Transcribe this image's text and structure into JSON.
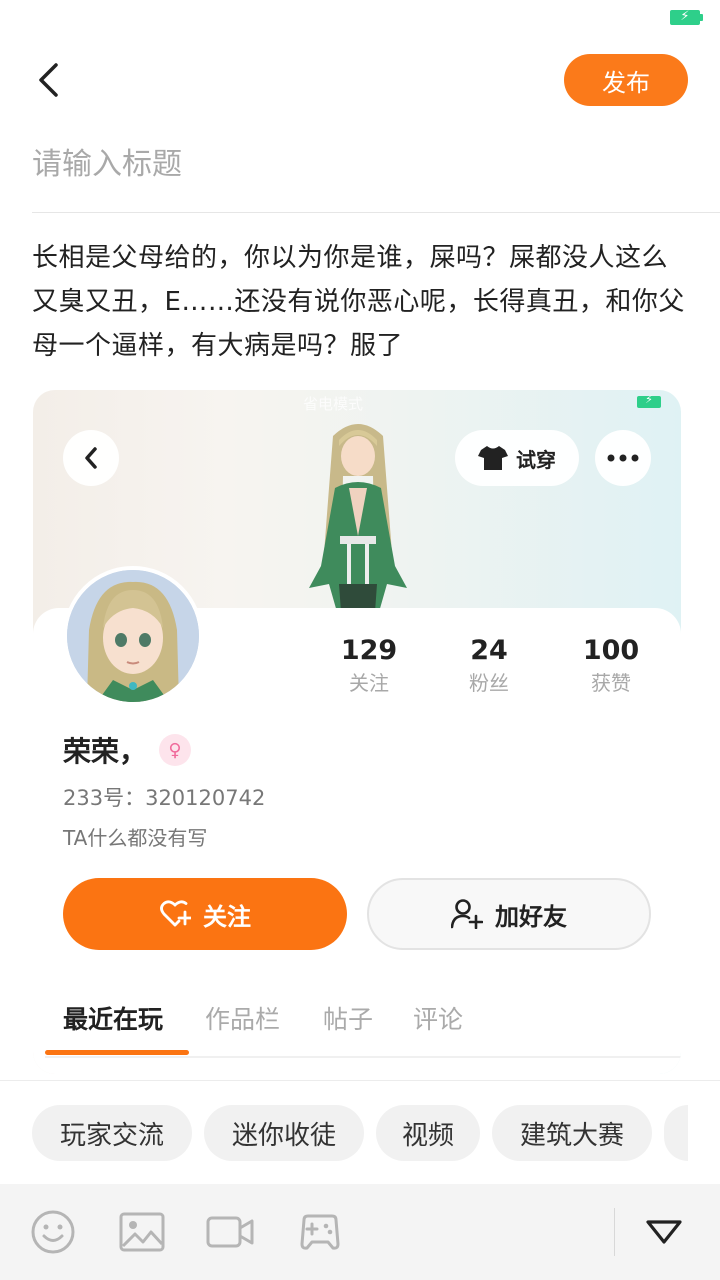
{
  "header": {
    "publish_label": "发布"
  },
  "title_input": {
    "placeholder": "请输入标题",
    "value": ""
  },
  "post_body": "长相是父母给的，你以为你是谁，屎吗？屎都没人这么又臭又丑，E……还没有说你恶心呢，长得真丑，和你父母一个逼样，有大病是吗？服了",
  "embedded_profile": {
    "status_center": "省电模式",
    "try_on_label": "试穿",
    "stats": [
      {
        "value": "129",
        "label": "关注"
      },
      {
        "value": "24",
        "label": "粉丝"
      },
      {
        "value": "100",
        "label": "获赞"
      }
    ],
    "name": "荣荣，",
    "gender_icon": "female-symbol",
    "uid": "233号：320120742",
    "bio": "TA什么都没有写",
    "follow_label": "关注",
    "add_friend_label": "加好友",
    "tabs": [
      "最近在玩",
      "作品栏",
      "帖子",
      "评论"
    ],
    "active_tab": "最近在玩"
  },
  "topics": [
    "玩家交流",
    "迷你收徒",
    "视频",
    "建筑大赛"
  ],
  "toolbar": {
    "icons": [
      "emoji-icon",
      "image-icon",
      "video-icon",
      "game-icon",
      "collapse-triangle-icon"
    ]
  },
  "colors": {
    "accent": "#fb7a1a",
    "battery": "#2ecf8a"
  }
}
